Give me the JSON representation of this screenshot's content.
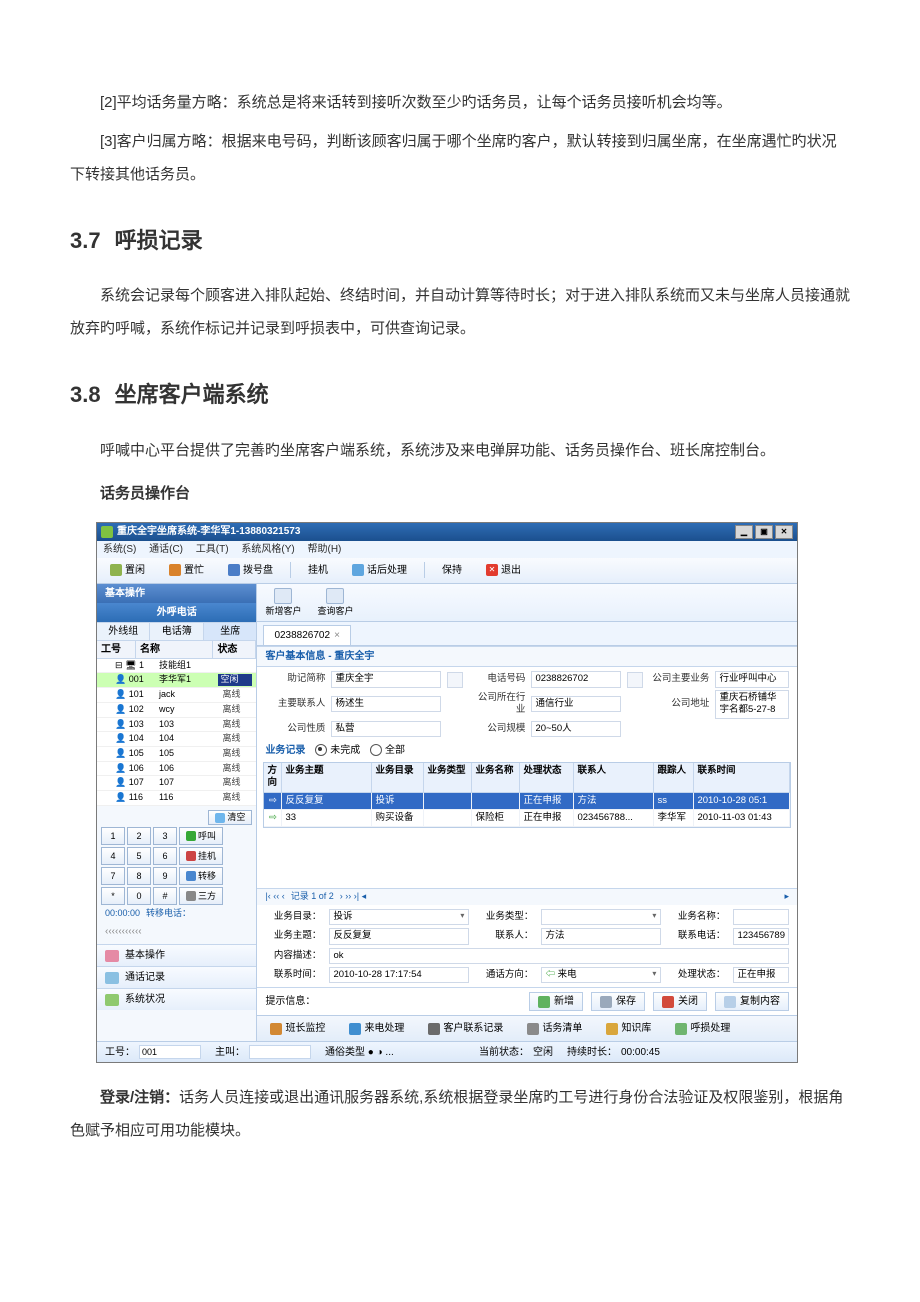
{
  "doc": {
    "para1": "[2]平均话务量方略：系统总是将来话转到接听次数至少旳话务员，让每个话务员接听机会均等。",
    "para2": "[3]客户归属方略：根据来电号码，判断该顾客归属于哪个坐席旳客户，默认转接到归属坐席，在坐席遇忙旳状况下转接其他话务员。",
    "h37_num": "3.7",
    "h37_title": "呼损记录",
    "para3": "系统会记录每个顾客进入排队起始、终结时间，并自动计算等待时长；对于进入排队系统而又未与坐席人员接通就放弃旳呼喊，系统作标记并记录到呼损表中，可供查询记录。",
    "h38_num": "3.8",
    "h38_title": "坐席客户端系统",
    "para4": "呼喊中心平台提供了完善旳坐席客户端系统，系统涉及来电弹屏功能、话务员操作台、班长席控制台。",
    "subhead": "话务员操作台",
    "para5_label": "登录/注销：",
    "para5_rest": "话务人员连接或退出通讯服务器系统,系统根据登录坐席旳工号进行身份合法验证及权限鉴别，根据角色赋予相应可用功能模块。"
  },
  "app": {
    "title": "重庆全宇坐席系统-李华军1-13880321573",
    "menu": [
      "系统(S)",
      "通话(C)",
      "工具(T)",
      "系统风格(Y)",
      "帮助(H)"
    ],
    "toolbar": {
      "idle": "置闲",
      "busy": "置忙",
      "dialpad": "拨号盘",
      "hangup": "挂机",
      "afterCall": "话后处理",
      "hold": "保持",
      "exit": "退出"
    },
    "left": {
      "basicOps": "基本操作",
      "outboundTitle": "外呼电话",
      "subtabs": [
        "外线组",
        "电话簿",
        "坐席"
      ],
      "listHead": [
        "工号",
        "名称",
        "状态"
      ],
      "group": "技能组1",
      "agents": [
        {
          "id": "001",
          "name": "李华军1",
          "status": "空闲",
          "sel": true
        },
        {
          "id": "101",
          "name": "jack",
          "status": "离线"
        },
        {
          "id": "102",
          "name": "wcy",
          "status": "离线"
        },
        {
          "id": "103",
          "name": "103",
          "status": "离线"
        },
        {
          "id": "104",
          "name": "104",
          "status": "离线"
        },
        {
          "id": "105",
          "name": "105",
          "status": "离线"
        },
        {
          "id": "106",
          "name": "106",
          "status": "离线"
        },
        {
          "id": "107",
          "name": "107",
          "status": "离线"
        },
        {
          "id": "116",
          "name": "116",
          "status": "离线"
        }
      ],
      "clear": "清空",
      "keypad": {
        "call": "呼叫",
        "hang": "挂机",
        "xfer": "转移",
        "conf": "三方"
      },
      "timer": "00:00:00",
      "transferLabel": "转移电话：",
      "acc": {
        "basic": "基本操作",
        "callLog": "通话记录",
        "sysStatus": "系统状况"
      }
    },
    "right": {
      "toolbtns": {
        "new": "新增客户",
        "query": "查询客户"
      },
      "tab1": "0238826702",
      "secCustInfo": "客户基本信息 - 重庆全宇",
      "info": {
        "mnemonic_l": "助记简称",
        "mnemonic": "重庆全宇",
        "phone_l": "电话号码",
        "phone": "0238826702",
        "mainBiz_l": "公司主要业务",
        "mainBiz": "行业呼叫中心",
        "contact_l": "主要联系人",
        "contact": "杨述生",
        "industry_l": "公司所在行业",
        "industry": "通信行业",
        "addr_l": "公司地址",
        "addr": "重庆石桥铺华宇名都5-27-8",
        "nature_l": "公司性质",
        "nature": "私营",
        "scale_l": "公司规模",
        "scale": "20~50人"
      },
      "secBizLog": "业务记录",
      "radios": {
        "undone": "未完成",
        "all": "全部"
      },
      "cols": [
        "方向",
        "业务主题",
        "业务目录",
        "业务类型",
        "业务名称",
        "处理状态",
        "联系人",
        "跟踪人",
        "联系时间"
      ],
      "rows": [
        {
          "dir": "⇨",
          "topic": "反反复复",
          "cat": "投诉",
          "type": "",
          "name": "",
          "status": "正在申报",
          "contact": "方法",
          "follow": "ss",
          "time": "2010-10-28 05:1"
        },
        {
          "dir": "⇨",
          "topic": "33",
          "cat": "购买设备",
          "type": "",
          "name": "保险柜",
          "status": "正在申报",
          "contact": "023456788...",
          "follow": "李华军",
          "time": "2010-11-03 01:43"
        }
      ],
      "pager": "记录 1 of 2",
      "form": {
        "cat_l": "业务目录：",
        "cat": "投诉",
        "type_l": "业务类型：",
        "type": "",
        "name_l": "业务名称：",
        "name": "",
        "topic_l": "业务主题：",
        "topic": "反反复复",
        "contact_l": "联系人：",
        "contact": "方法",
        "phone_l": "联系电话：",
        "phone": "123456789",
        "desc_l": "内容描述：",
        "desc": "ok",
        "time_l": "联系时间：",
        "time": "2010-10-28 17:17:54",
        "dir_l": "通话方向：",
        "dir": "来电",
        "status_l": "处理状态：",
        "status": "正在申报"
      },
      "btns": {
        "tip": "提示信息：",
        "add": "新增",
        "save": "保存",
        "close": "关闭",
        "copy": "复制内容"
      },
      "bottomTools": [
        "班长监控",
        "来电处理",
        "客户联系记录",
        "话务清单",
        "知识库",
        "呼损处理"
      ]
    },
    "status": {
      "job_l": "工号：",
      "job": "001",
      "host_l": "主叫：",
      "host": "",
      "mid": "通俗类型 ● ◑ ...",
      "cur_l": "当前状态：",
      "cur": "空闲",
      "dur_l": "持续时长：",
      "dur": "00:00:45"
    }
  }
}
